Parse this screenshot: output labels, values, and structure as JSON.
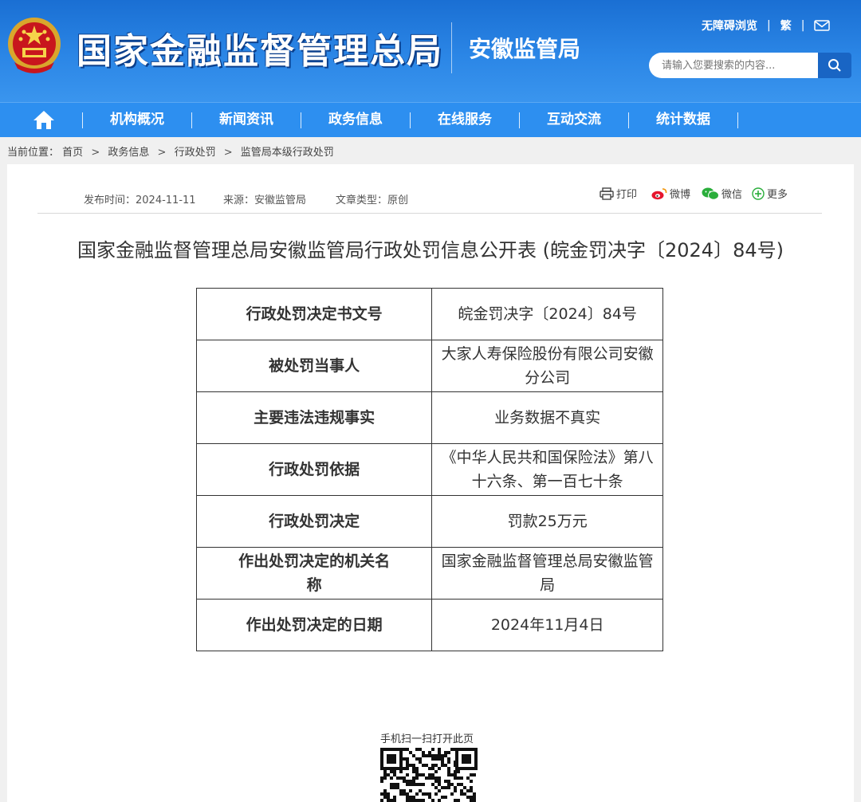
{
  "header": {
    "site_title": "国家金融监督管理总局",
    "sub_title": "安徽监管局",
    "links": {
      "accessibility": "无障碍浏览",
      "traditional": "繁",
      "separator": "|"
    },
    "search": {
      "placeholder": "请输入您要搜索的内容..."
    }
  },
  "nav": {
    "items": [
      {
        "label": "机构概况"
      },
      {
        "label": "新闻资讯"
      },
      {
        "label": "政务信息"
      },
      {
        "label": "在线服务"
      },
      {
        "label": "互动交流"
      },
      {
        "label": "统计数据"
      }
    ]
  },
  "breadcrumb": {
    "prefix": "当前位置：",
    "items": [
      "首页",
      "政务信息",
      "行政处罚",
      "监管局本级行政处罚"
    ],
    "separator": ">"
  },
  "article": {
    "publish_time": "发布时间：2024-11-11",
    "source": "来源：安徽监管局",
    "type": "文章类型：原创",
    "share": {
      "print": "打印",
      "weibo": "微博",
      "wechat": "微信",
      "more": "更多"
    },
    "title": "国家金融监督管理总局安徽监管局行政处罚信息公开表 (皖金罚决字〔2024〕84号)",
    "table": [
      {
        "key": "行政处罚决定书文号",
        "value": "皖金罚决字〔2024〕84号"
      },
      {
        "key": "被处罚当事人",
        "value": "大家人寿保险股份有限公司安徽分公司"
      },
      {
        "key": "主要违法违规事实",
        "value": "业务数据不真实"
      },
      {
        "key": "行政处罚依据",
        "value": "《中华人民共和国保险法》第八十六条、第一百七十条"
      },
      {
        "key": "行政处罚决定",
        "value": "罚款25万元"
      },
      {
        "key": "作出处罚决定的机关名称",
        "value": "国家金融监督管理总局安徽监管局"
      },
      {
        "key": "作出处罚决定的日期",
        "value": "2024年11月4日"
      }
    ],
    "qr_caption": "手机扫一扫打开此页"
  },
  "colors": {
    "header_blue": "#1a6fd3",
    "nav_blue": "#2d8ff0",
    "search_button": "#1965c4"
  }
}
